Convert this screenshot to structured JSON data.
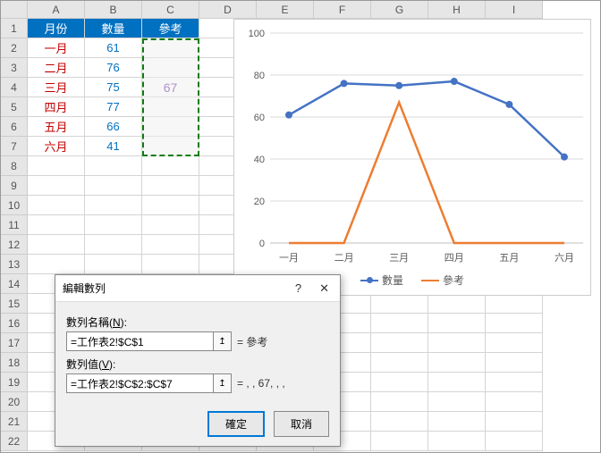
{
  "columns": [
    "A",
    "B",
    "C",
    "D",
    "E",
    "F",
    "G",
    "H",
    "I"
  ],
  "rows": [
    "1",
    "2",
    "3",
    "4",
    "5",
    "6",
    "7",
    "8",
    "9",
    "10",
    "11",
    "12",
    "13",
    "14",
    "15",
    "16",
    "17",
    "18",
    "19",
    "20",
    "21",
    "22"
  ],
  "header": {
    "a": "月份",
    "b": "數量",
    "c": "參考"
  },
  "data_rows": [
    {
      "m": "一月",
      "v": "61"
    },
    {
      "m": "二月",
      "v": "76"
    },
    {
      "m": "三月",
      "v": "75"
    },
    {
      "m": "四月",
      "v": "77"
    },
    {
      "m": "五月",
      "v": "66"
    },
    {
      "m": "六月",
      "v": "41"
    }
  ],
  "ref_value": "67",
  "dialog": {
    "title": "編輯數列",
    "name_label_prefix": "數列名稱(",
    "name_key": "N",
    "name_label_suffix": "):",
    "name_value": "=工作表2!$C$1",
    "name_preview": "= 參考",
    "values_label_prefix": "數列值(",
    "values_key": "V",
    "values_label_suffix": "):",
    "values_value": "=工作表2!$C$2:$C$7",
    "values_preview": "= , , 67, , ,",
    "ok": "確定",
    "cancel": "取消"
  },
  "chart_data": {
    "type": "line",
    "categories": [
      "一月",
      "二月",
      "三月",
      "四月",
      "五月",
      "六月"
    ],
    "series": [
      {
        "name": "數量",
        "values": [
          61,
          76,
          75,
          77,
          66,
          41
        ],
        "color": "#4472C4"
      },
      {
        "name": "參考",
        "values": [
          0,
          0,
          67,
          0,
          0,
          0
        ],
        "color": "#ED7D31"
      }
    ],
    "ylim": [
      0,
      100
    ],
    "yticks": [
      0,
      20,
      40,
      60,
      80,
      100
    ]
  }
}
